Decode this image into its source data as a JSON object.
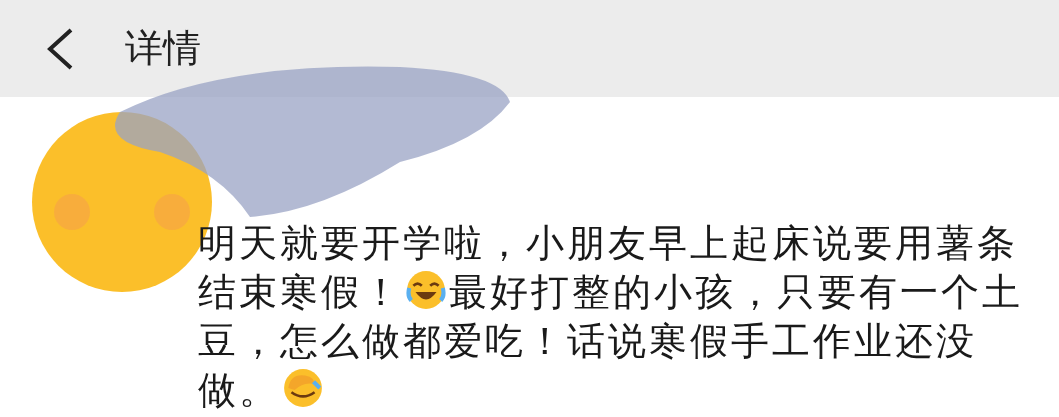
{
  "header": {
    "title": "详情"
  },
  "post": {
    "segments": [
      {
        "kind": "text",
        "text": "明天就要开学啦，小朋友早上起床说要用薯条结束寒假！"
      },
      {
        "kind": "laugh"
      },
      {
        "kind": "text",
        "text": "最好打整的小孩，只要有一个土豆，怎么做都爱吃！话说寒假手工作业还没做。"
      },
      {
        "kind": "facepalm"
      }
    ]
  }
}
